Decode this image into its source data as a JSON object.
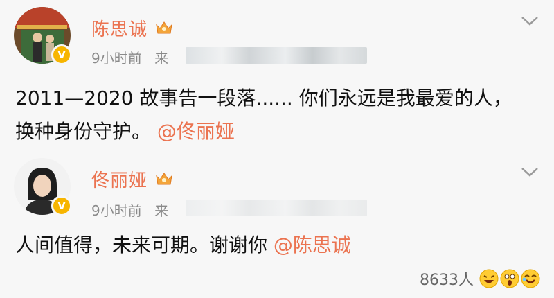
{
  "posts": [
    {
      "author": "陈思诚",
      "time": "9小时前",
      "source_prefix": "来",
      "content": "2011—2020 故事告一段落...... 你们永远是我最爱的人，换种身份守护。",
      "mention": "@佟丽娅"
    },
    {
      "author": "佟丽娅",
      "time": "9小时前",
      "source_prefix": "来",
      "content": "人间值得，未来可期。谢谢你",
      "mention": "@陈思诚"
    }
  ],
  "likes": {
    "count": "8633人"
  },
  "icons": [
    "verified-badge-icon",
    "crown-vip-icon",
    "chevron-down-icon",
    "laugh-emoji-icon",
    "surprise-emoji-icon",
    "lol-emoji-icon"
  ],
  "colors": {
    "accent": "#eb7350",
    "badge": "#f7b500",
    "meta": "#8a8a8a",
    "background": "#f7f7f7"
  }
}
